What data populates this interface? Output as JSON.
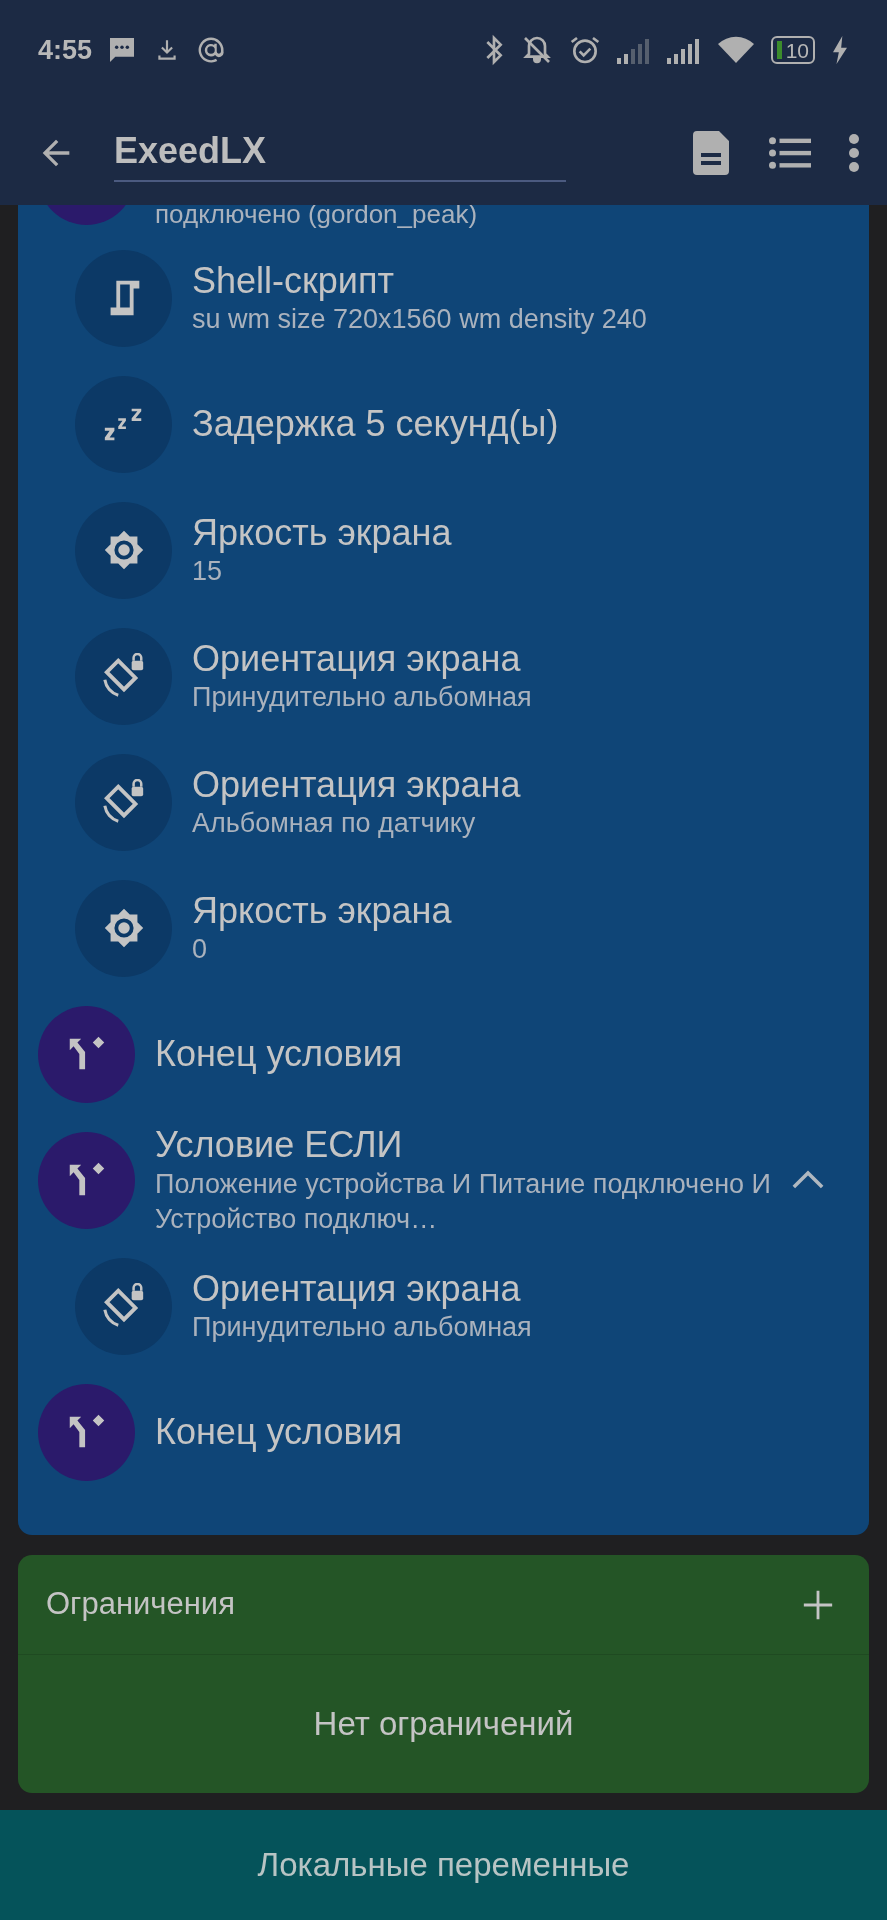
{
  "status_bar": {
    "time": "4:55",
    "battery": "10"
  },
  "toolbar": {
    "title": "ExeedLX"
  },
  "blocks": [
    {
      "kind": "if",
      "subtitle": "подключено (gordon_peak)",
      "children": [
        {
          "kind": "shell",
          "title": "Shell-скрипт",
          "subtitle": "su wm size 720x1560 wm density 240"
        },
        {
          "kind": "delay",
          "title": "Задержка 5 секунд(ы)"
        },
        {
          "kind": "brightness",
          "title": "Яркость экрана",
          "subtitle": "15"
        },
        {
          "kind": "orientation",
          "title": "Ориентация экрана",
          "subtitle": "Принудительно альбомная"
        },
        {
          "kind": "orientation",
          "title": "Ориентация экрана",
          "subtitle": "Альбомная по датчику"
        },
        {
          "kind": "brightness",
          "title": "Яркость экрана",
          "subtitle": "0"
        }
      ]
    },
    {
      "kind": "end",
      "title": "Конец условия"
    },
    {
      "kind": "if",
      "title": "Условие ЕСЛИ",
      "subtitle": "Положение устройства И Питание подключено И Устройство подключ…",
      "expanded": true,
      "children": [
        {
          "kind": "orientation",
          "title": "Ориентация экрана",
          "subtitle": "Принудительно альбомная"
        }
      ]
    },
    {
      "kind": "end",
      "title": "Конец условия"
    }
  ],
  "constraints": {
    "title": "Ограничения",
    "empty_text": "Нет ограничений"
  },
  "bottom_bar": {
    "label": "Локальные переменные"
  }
}
